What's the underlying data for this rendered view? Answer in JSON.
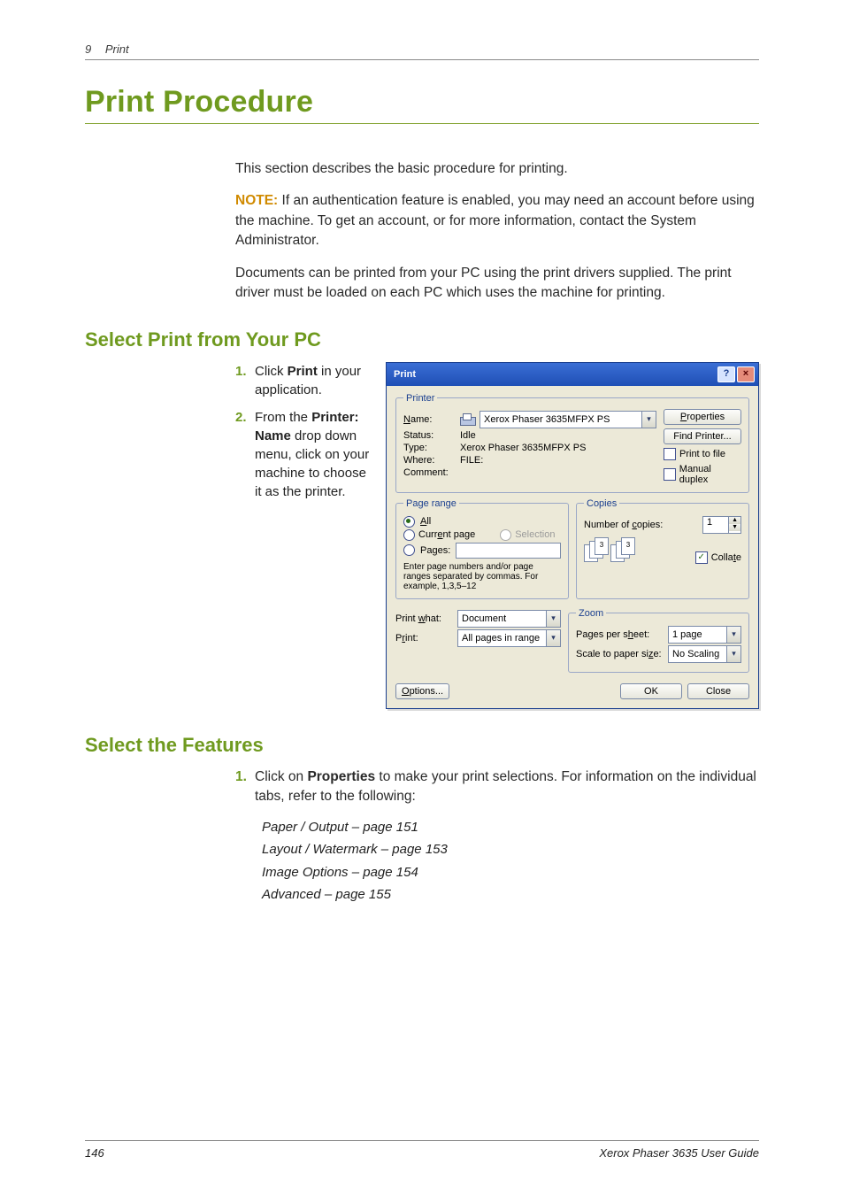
{
  "header": {
    "chapter_num": "9",
    "chapter_title": "Print"
  },
  "title": "Print Procedure",
  "intro": "This section describes the basic procedure for printing.",
  "note_label": "NOTE:",
  "note_body": " If an authentication feature is enabled, you may need an account before using the machine. To get an account, or for more information, contact the System Administrator.",
  "intro2": "Documents can be printed from your PC using the print drivers supplied. The print driver must be loaded on each PC which uses the machine for printing.",
  "section1": {
    "heading": "Select Print from Your PC",
    "steps": [
      {
        "num": "1.",
        "pre": "Click ",
        "bold": "Print",
        "post": " in your application."
      },
      {
        "num": "2.",
        "pre": "From the ",
        "bold": "Printer: Name",
        "post": " drop down menu, click on your machine to choose it as the printer."
      }
    ]
  },
  "section2": {
    "heading": "Select the Features",
    "step": {
      "num": "1.",
      "pre": "Click on ",
      "bold": "Properties",
      "post": " to make your print selections. For information on the individual tabs, refer to the following:"
    },
    "refs": [
      "Paper / Output – page 151",
      "Layout / Watermark – page 153",
      "Image Options – page 154",
      "Advanced – page 155"
    ]
  },
  "footer": {
    "page": "146",
    "guide": "Xerox Phaser 3635 User Guide"
  },
  "dialog": {
    "title": "Print",
    "help": "?",
    "close": "×",
    "printer": {
      "legend": "Printer",
      "name_label": "Name:",
      "name_value": "Xerox Phaser 3635MFPX PS",
      "status_label": "Status:",
      "status_value": "Idle",
      "type_label": "Type:",
      "type_value": "Xerox Phaser 3635MFPX PS",
      "where_label": "Where:",
      "where_value": "FILE:",
      "comment_label": "Comment:",
      "comment_value": "",
      "btn_properties": "Properties",
      "btn_find": "Find Printer...",
      "chk_file": "Print to file",
      "chk_duplex": "Manual duplex"
    },
    "range": {
      "legend": "Page range",
      "all": "All",
      "current": "Current page",
      "selection": "Selection",
      "pages": "Pages:",
      "hint": "Enter page numbers and/or page ranges separated by commas. For example, 1,3,5–12"
    },
    "copies": {
      "legend": "Copies",
      "num_label": "Number of copies:",
      "num_value": "1",
      "collate": "Collate"
    },
    "printwhat_label": "Print what:",
    "printwhat_value": "Document",
    "print_label": "Print:",
    "print_value": "All pages in range",
    "zoom": {
      "legend": "Zoom",
      "pps_label": "Pages per sheet:",
      "pps_value": "1 page",
      "scale_label": "Scale to paper size:",
      "scale_value": "No Scaling"
    },
    "btn_options": "Options...",
    "btn_ok": "OK",
    "btn_close": "Close"
  }
}
